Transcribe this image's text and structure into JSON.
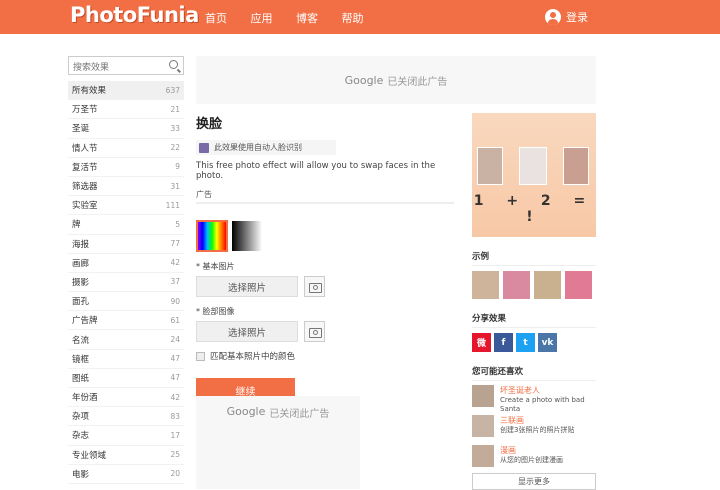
{
  "header": {
    "logo": "PhotoFunia",
    "nav": [
      "首页",
      "应用",
      "博客",
      "帮助"
    ],
    "login": "登录"
  },
  "sidebar": {
    "search_placeholder": "搜索效果",
    "categories": [
      {
        "label": "所有效果",
        "count": "637"
      },
      {
        "label": "万圣节",
        "count": "21"
      },
      {
        "label": "圣诞",
        "count": "33"
      },
      {
        "label": "情人节",
        "count": "22"
      },
      {
        "label": "复活节",
        "count": "9"
      },
      {
        "label": "筛选器",
        "count": "31"
      },
      {
        "label": "实验室",
        "count": "111"
      },
      {
        "label": "牌",
        "count": "5"
      },
      {
        "label": "海报",
        "count": "77"
      },
      {
        "label": "画廊",
        "count": "42"
      },
      {
        "label": "摄影",
        "count": "37"
      },
      {
        "label": "面孔",
        "count": "90"
      },
      {
        "label": "广告牌",
        "count": "61"
      },
      {
        "label": "名流",
        "count": "24"
      },
      {
        "label": "镜框",
        "count": "47"
      },
      {
        "label": "图纸",
        "count": "47"
      },
      {
        "label": "年份酒",
        "count": "42"
      },
      {
        "label": "杂项",
        "count": "83"
      },
      {
        "label": "杂志",
        "count": "17"
      },
      {
        "label": "专业领域",
        "count": "25"
      },
      {
        "label": "电影",
        "count": "20"
      }
    ]
  },
  "ads": {
    "google": "Google",
    "closed": "已关闭此广告"
  },
  "main": {
    "title": "换脸",
    "face_note": "此效果使用自动人脸识别",
    "description": "This free photo effect will allow you to swap faces in the photo.",
    "ad_label": "广告",
    "field1_label": "* 基本图片",
    "field2_label": "* 脸部图像",
    "pick_photo": "选择照片",
    "match_color": "匹配基本照片中的颜色",
    "continue": "继续"
  },
  "right": {
    "equation": "1 + 2 = !",
    "examples_heading": "示例",
    "share_heading": "分享效果",
    "share_icons": [
      "weibo-icon",
      "facebook-icon",
      "twitter-icon",
      "vk-icon"
    ],
    "share_glyphs": [
      "微",
      "f",
      "t",
      "vk"
    ],
    "share_colors": [
      "#e6162d",
      "#3b5998",
      "#1da1f2",
      "#4a76a8"
    ],
    "recommend_heading": "您可能还喜欢",
    "recommendations": [
      {
        "title": "坏圣诞老人",
        "desc": "Create a photo with bad Santa"
      },
      {
        "title": "三联画",
        "desc": "创建3张照片的照片拼贴"
      },
      {
        "title": "漫画",
        "desc": "从您的图片创建漫画"
      }
    ],
    "more": "显示更多"
  }
}
